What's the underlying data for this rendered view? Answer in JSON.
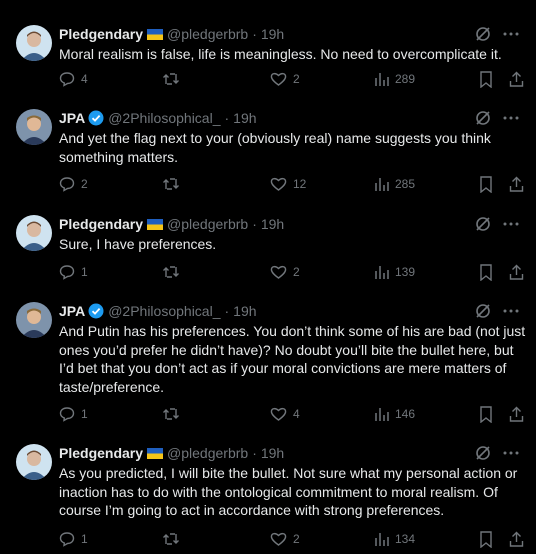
{
  "tweets": [
    {
      "name": "Pledgendary",
      "handle": "@pledgerbrb",
      "dot": "·",
      "time": "19h",
      "flag": true,
      "verified": false,
      "avatar_color": "#cfe3f0",
      "text": "Moral realism is false, life is meaningless. No need to overcomplicate it.",
      "replies": "4",
      "retweets": "",
      "likes": "2",
      "views": "289"
    },
    {
      "name": "JPA",
      "handle": "@2Philosophical_",
      "dot": "·",
      "time": "19h",
      "flag": false,
      "verified": true,
      "avatar_color": "#8b9fb5",
      "text": "And yet the flag next to your (obviously real) name suggests you think something matters.",
      "replies": "2",
      "retweets": "",
      "likes": "12",
      "views": "285"
    },
    {
      "name": "Pledgendary",
      "handle": "@pledgerbrb",
      "dot": "·",
      "time": "19h",
      "flag": true,
      "verified": false,
      "avatar_color": "#cfe3f0",
      "text": "Sure, I have preferences.",
      "replies": "1",
      "retweets": "",
      "likes": "2",
      "views": "139"
    },
    {
      "name": "JPA",
      "handle": "@2Philosophical_",
      "dot": "·",
      "time": "19h",
      "flag": false,
      "verified": true,
      "avatar_color": "#8b9fb5",
      "text": "And Putin has his preferences. You don’t think some of his are bad (not just ones you’d prefer he didn’t have)? No doubt you’ll bite the bullet here, but I’d bet that you don’t act as if your moral convictions are mere matters of taste/preference.",
      "replies": "1",
      "retweets": "",
      "likes": "4",
      "views": "146"
    },
    {
      "name": "Pledgendary",
      "handle": "@pledgerbrb",
      "dot": "·",
      "time": "19h",
      "flag": true,
      "verified": false,
      "avatar_color": "#cfe3f0",
      "text": "As you predicted, I will bite the bullet. Not sure what my personal action or inaction has to do with the ontological commitment to moral realism. Of course I’m going to act in accordance with strong preferences.",
      "replies": "1",
      "retweets": "",
      "likes": "2",
      "views": "134"
    }
  ],
  "colors": {
    "background": "#000000",
    "text": "#e7e9ea",
    "muted": "#71767b",
    "verified": "#1d9bf0",
    "flag_blue": "#1f5fbf",
    "flag_yellow": "#f5c518"
  },
  "icons": [
    "reply-icon",
    "retweet-icon",
    "like-icon",
    "views-icon",
    "bookmark-icon",
    "share-icon",
    "grok-icon",
    "more-icon",
    "verified-icon",
    "ukraine-flag-icon"
  ]
}
